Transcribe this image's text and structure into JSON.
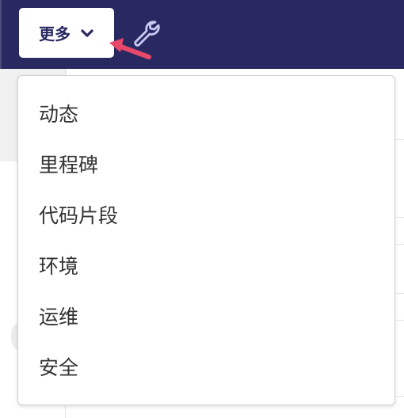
{
  "nav": {
    "more_label": "更多",
    "more_icon": "chevron-down-icon",
    "tool_icon": "wrench-icon",
    "background_color": "#292961",
    "annotation_color": "#e8496a"
  },
  "dropdown": {
    "items": [
      {
        "label": "动态"
      },
      {
        "label": "里程碑"
      },
      {
        "label": "代码片段"
      },
      {
        "label": "环境"
      },
      {
        "label": "运维"
      },
      {
        "label": "安全"
      }
    ]
  }
}
